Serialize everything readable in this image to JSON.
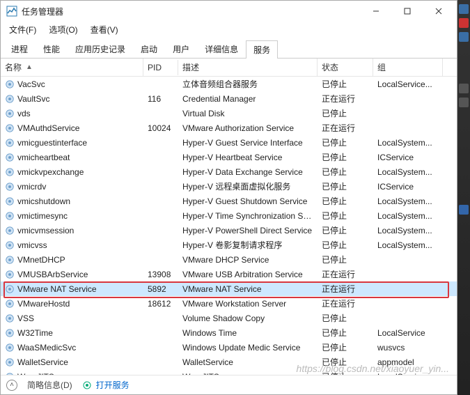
{
  "window": {
    "title": "任务管理器"
  },
  "menu": {
    "file": "文件(F)",
    "options": "选项(O)",
    "view": "查看(V)"
  },
  "tabs": {
    "processes": "进程",
    "performance": "性能",
    "apphistory": "应用历史记录",
    "startup": "启动",
    "users": "用户",
    "details": "详细信息",
    "services": "服务"
  },
  "columns": {
    "name": "名称",
    "pid": "PID",
    "desc": "描述",
    "status": "状态",
    "group": "组"
  },
  "status_labels": {
    "stopped": "已停止",
    "running": "正在运行"
  },
  "services": [
    {
      "name": "VacSvc",
      "pid": "",
      "desc": "立体音频组合器服务",
      "status": "已停止",
      "group": "LocalService..."
    },
    {
      "name": "VaultSvc",
      "pid": "116",
      "desc": "Credential Manager",
      "status": "正在运行",
      "group": ""
    },
    {
      "name": "vds",
      "pid": "",
      "desc": "Virtual Disk",
      "status": "已停止",
      "group": ""
    },
    {
      "name": "VMAuthdService",
      "pid": "10024",
      "desc": "VMware Authorization Service",
      "status": "正在运行",
      "group": ""
    },
    {
      "name": "vmicguestinterface",
      "pid": "",
      "desc": "Hyper-V Guest Service Interface",
      "status": "已停止",
      "group": "LocalSystem..."
    },
    {
      "name": "vmicheartbeat",
      "pid": "",
      "desc": "Hyper-V Heartbeat Service",
      "status": "已停止",
      "group": "ICService"
    },
    {
      "name": "vmickvpexchange",
      "pid": "",
      "desc": "Hyper-V Data Exchange Service",
      "status": "已停止",
      "group": "LocalSystem..."
    },
    {
      "name": "vmicrdv",
      "pid": "",
      "desc": "Hyper-V 远程桌面虚拟化服务",
      "status": "已停止",
      "group": "ICService"
    },
    {
      "name": "vmicshutdown",
      "pid": "",
      "desc": "Hyper-V Guest Shutdown Service",
      "status": "已停止",
      "group": "LocalSystem..."
    },
    {
      "name": "vmictimesync",
      "pid": "",
      "desc": "Hyper-V Time Synchronization Se...",
      "status": "已停止",
      "group": "LocalSystem..."
    },
    {
      "name": "vmicvmsession",
      "pid": "",
      "desc": "Hyper-V PowerShell Direct Service",
      "status": "已停止",
      "group": "LocalSystem..."
    },
    {
      "name": "vmicvss",
      "pid": "",
      "desc": "Hyper-V 卷影复制请求程序",
      "status": "已停止",
      "group": "LocalSystem..."
    },
    {
      "name": "VMnetDHCP",
      "pid": "",
      "desc": "VMware DHCP Service",
      "status": "已停止",
      "group": ""
    },
    {
      "name": "VMUSBArbService",
      "pid": "13908",
      "desc": "VMware USB Arbitration Service",
      "status": "正在运行",
      "group": ""
    },
    {
      "name": "VMware NAT Service",
      "pid": "5892",
      "desc": "VMware NAT Service",
      "status": "正在运行",
      "group": "",
      "selected": true
    },
    {
      "name": "VMwareHostd",
      "pid": "18612",
      "desc": "VMware Workstation Server",
      "status": "正在运行",
      "group": ""
    },
    {
      "name": "VSS",
      "pid": "",
      "desc": "Volume Shadow Copy",
      "status": "已停止",
      "group": ""
    },
    {
      "name": "W32Time",
      "pid": "",
      "desc": "Windows Time",
      "status": "已停止",
      "group": "LocalService"
    },
    {
      "name": "WaaSMedicSvc",
      "pid": "",
      "desc": "Windows Update Medic Service",
      "status": "已停止",
      "group": "wusvcs"
    },
    {
      "name": "WalletService",
      "pid": "",
      "desc": "WalletService",
      "status": "已停止",
      "group": "appmodel"
    },
    {
      "name": "WarpJITSvc",
      "pid": "",
      "desc": "WarpJITSvc",
      "status": "已停止",
      "group": "LocalService..."
    }
  ],
  "statusbar": {
    "brief": "简略信息(D)",
    "open_services": "打开服务"
  },
  "watermark": "https://blog.csdn.net/xiaoyuer_yin..."
}
